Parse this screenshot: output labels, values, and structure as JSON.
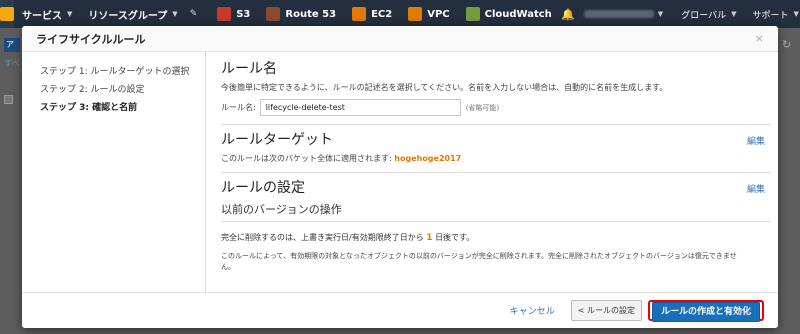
{
  "topnav": {
    "services": "サービス",
    "resource_groups": "リソースグループ",
    "shortcuts": [
      {
        "label": "S3",
        "icon": "s3-icon",
        "color": "#c7392b"
      },
      {
        "label": "Route 53",
        "icon": "route53-icon",
        "color": "#8c4a2f"
      },
      {
        "label": "EC2",
        "icon": "ec2-icon",
        "color": "#e07b00"
      },
      {
        "label": "VPC",
        "icon": "vpc-icon",
        "color": "#e07b00"
      },
      {
        "label": "CloudWatch",
        "icon": "cloudwatch-icon",
        "color": "#759c3e"
      }
    ],
    "region": "グローバル",
    "support": "サポート"
  },
  "background": {
    "button": "ア",
    "link": "すべ"
  },
  "modal": {
    "title": "ライフサイクルルール",
    "close": "×",
    "steps": [
      "ステップ 1: ルールターゲットの選択",
      "ステップ 2: ルールの設定",
      "ステップ 3: 確認と名前"
    ],
    "rule_name": {
      "title": "ルール名",
      "description": "今後簡単に特定できるように、ルールの記述名を選択してください。名前を入力しない場合は、自動的に名前を生成します。",
      "label": "ルール名:",
      "value": "lifecycle-delete-test",
      "hint": "(省略可能)"
    },
    "rule_target": {
      "title": "ルールターゲット",
      "edit": "編集",
      "text": "このルールは次のバケット全体に適用されます:",
      "bucket": "hogehoge2017"
    },
    "rule_settings": {
      "title": "ルールの設定",
      "edit": "編集",
      "subtitle": "以前のバージョンの操作",
      "delete_prefix": "完全に削除するのは、上書き実行日/有効期限終了日から",
      "delete_days": "1",
      "delete_suffix": "日後です。",
      "note": "このルールによって、有効期限の対象となったオブジェクトの以前のバージョンが完全に削除されます。完全に削除されたオブジェクトのバージョンは復元できません。"
    },
    "footer": {
      "cancel": "キャンセル",
      "back": "< ルールの設定",
      "create": "ルールの作成と有効化"
    }
  }
}
